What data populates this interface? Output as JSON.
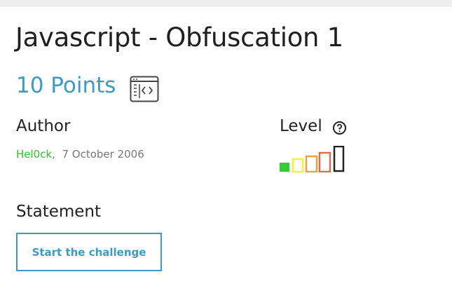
{
  "challenge": {
    "title": "Javascript - Obfuscation 1",
    "points": "10 Points",
    "category_icon": "web-client-icon"
  },
  "author": {
    "heading": "Author",
    "name": "Hel0ck",
    "separator": ",",
    "date": "7 October 2006"
  },
  "level": {
    "heading": "Level",
    "help_icon": "question-circle-icon",
    "value": 1,
    "max": 5,
    "colors": [
      "#33cc33",
      "#f2f23a",
      "#f0a040",
      "#e26a4a",
      "#222222"
    ]
  },
  "statement": {
    "heading": "Statement",
    "button_label": "Start the challenge"
  },
  "colors": {
    "accent": "#3d9bc1",
    "author_link": "#2fbf2f"
  }
}
